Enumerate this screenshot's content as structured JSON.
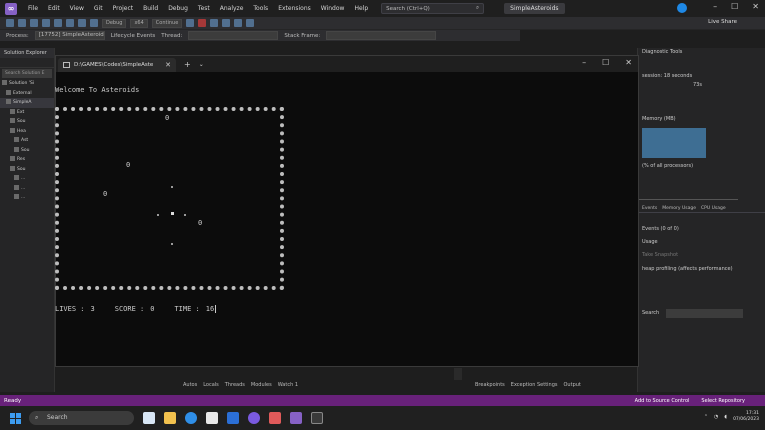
{
  "menubar": {
    "items": [
      "File",
      "Edit",
      "View",
      "Git",
      "Project",
      "Build",
      "Debug",
      "Test",
      "Analyze",
      "Tools",
      "Extensions",
      "Window",
      "Help"
    ],
    "search_placeholder": "Search (Ctrl+Q)",
    "solution_name": "SimpleAsteroids"
  },
  "toolbar": {
    "config": "Debug",
    "platform": "x64",
    "continue_label": "Continue",
    "live_share": "Live Share"
  },
  "toolbar2": {
    "process_label": "Process:",
    "process_value": "[17752] SimpleAsteroids.exe",
    "lifecycle_label": "Lifecycle Events",
    "thread_label": "Thread:",
    "stack_frame_label": "Stack Frame:"
  },
  "solution_explorer": {
    "title": "Solution Explorer",
    "search_placeholder": "Search Solution E",
    "tree": [
      "Solution 'Si",
      "External",
      "SimpleA",
      "Ext",
      "Sou",
      "Hea",
      "Ast",
      "Sou",
      "Res",
      "Sou",
      "...",
      "...",
      "..."
    ]
  },
  "diagnostics": {
    "title": "Diagnostic Tools",
    "session": "session: 18 seconds",
    "pct": "73s",
    "memory_label": "Memory (MB)",
    "cpu_label": "(% of all processors)",
    "tabs": [
      "Events",
      "Memory Usage",
      "CPU Usage"
    ],
    "events_count": "Events (0 of 0)",
    "usage_label": "Usage",
    "snapshot_label": "Take Snapshot",
    "heap_label": "heap profiling (affects performance)",
    "search_label": "Search"
  },
  "console": {
    "tab_title": "D:\\GAMES\\Codes\\SimpleAste",
    "welcome": "Welcome To Asteroids",
    "status": {
      "lives_label": "LIVES :",
      "lives": "3",
      "score_label": "SCORE :",
      "score": "0",
      "time_label": "TIME :",
      "time": "16"
    },
    "asteroid_glyph": "0"
  },
  "bottom_tabs_left": [
    "Autos",
    "Locals",
    "Threads",
    "Modules",
    "Watch 1"
  ],
  "bottom_tabs_right": [
    "Breakpoints",
    "Exception Settings",
    "Output"
  ],
  "statusbar": {
    "state": "Ready",
    "source_control": "Add to Source Control",
    "repository": "Select Repository"
  },
  "taskbar": {
    "search_label": "Search",
    "time": "17:31",
    "date": "07/06/2023"
  },
  "colors": {
    "status_bar": "#68217a",
    "accent": "#3d9cf0"
  }
}
